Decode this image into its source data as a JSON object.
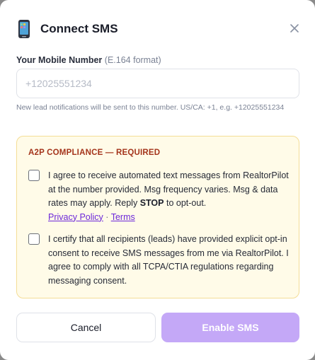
{
  "modal": {
    "title": "Connect SMS",
    "icon": "mobile-phone-icon",
    "close_icon": "close-icon"
  },
  "phone_field": {
    "label": "Your Mobile Number",
    "label_hint": "(E.164 format)",
    "placeholder": "+12025551234",
    "value": "",
    "helper": "New lead notifications will be sent to this number. US/CA: +1, e.g. +12025551234"
  },
  "compliance": {
    "title": "A2P COMPLIANCE — REQUIRED",
    "consent1": {
      "checked": false,
      "text_before": "I agree to receive automated text messages from RealtorPilot at the number provided. Msg frequency varies. Msg & data rates may apply. Reply ",
      "bold": "STOP",
      "text_after": " to opt-out.",
      "privacy_link": "Privacy Policy",
      "separator": "·",
      "terms_link": "Terms"
    },
    "consent2": {
      "checked": false,
      "text": "I certify that all recipients (leads) have provided explicit opt-in consent to receive SMS messages from me via RealtorPilot. I agree to comply with all TCPA/CTIA regulations regarding messaging consent."
    },
    "colors": {
      "background": "#fffbe8",
      "border": "#f4dd96",
      "title": "#a4341b"
    }
  },
  "buttons": {
    "cancel": "Cancel",
    "enable": "Enable SMS",
    "enable_color": "#c4a8f7"
  }
}
